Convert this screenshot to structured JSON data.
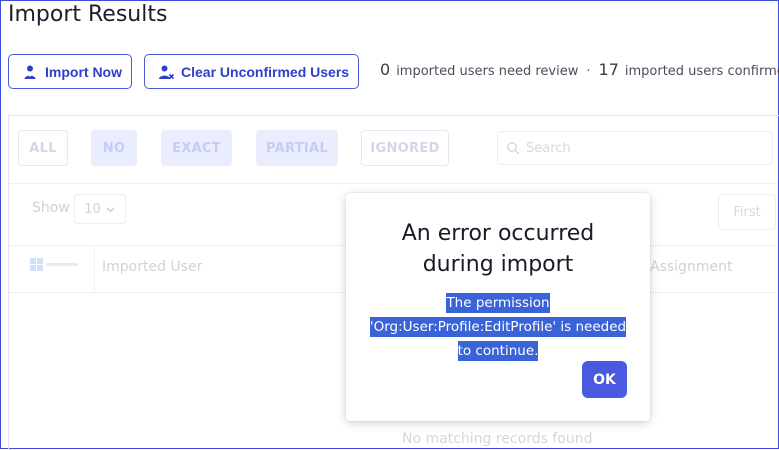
{
  "page": {
    "title": "Import Results"
  },
  "toolbar": {
    "import_now_label": "Import Now",
    "clear_unconfirmed_label": "Clear Unconfirmed Users"
  },
  "summary": {
    "review_count": "0",
    "review_text": "imported users need review",
    "separator": "·",
    "confirmed_count": "17",
    "confirmed_text": "imported users confirmed"
  },
  "filters": {
    "all": "ALL",
    "no": "NO",
    "exact": "EXACT",
    "partial": "PARTIAL",
    "ignored": "IGNORED"
  },
  "search": {
    "placeholder": "Search"
  },
  "table": {
    "show_label": "Show",
    "page_size": "10",
    "first_label": "First",
    "columns": {
      "imported_user": "Imported User",
      "assignment": "Assignment"
    },
    "empty_message": "No matching records found"
  },
  "modal": {
    "title_line1": "An error occurred",
    "title_line2": "during import",
    "message_line1": "The permission",
    "message_line2": "'Org:User:Profile:EditProfile' is needed",
    "message_line3": "to continue.",
    "ok_label": "OK"
  },
  "colors": {
    "accent": "#4a5ae0",
    "highlight": "#3a63d8",
    "frame": "#3d4fd8"
  }
}
